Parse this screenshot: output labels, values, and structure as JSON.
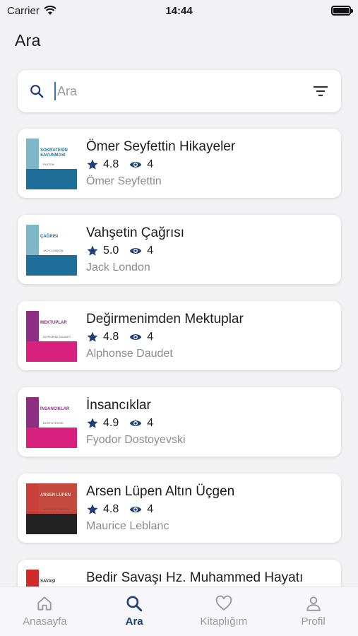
{
  "status_bar": {
    "carrier": "Carrier",
    "time": "14:44"
  },
  "page_title": "Ara",
  "search": {
    "placeholder": "Ara",
    "value": ""
  },
  "books": [
    {
      "title": "Ömer Seyfettin Hikayeler",
      "rating": "4.8",
      "views": "4",
      "author": "Ömer Seyfettin",
      "cover": {
        "band": "#7fb6c8",
        "bottom": "#1f6e9a",
        "bg": "#ffffff",
        "text": "SOKRATESİN SAVUNMASI",
        "text_color": "#1f6e9a",
        "sub": "PLATON"
      }
    },
    {
      "title": "Vahşetin Çağrısı",
      "rating": "5.0",
      "views": "4",
      "author": "Jack London",
      "cover": {
        "band": "#7fb6c8",
        "bottom": "#1f6e9a",
        "bg": "#ffffff",
        "text": "ÇAĞRISI",
        "text_color": "#1f6e9a",
        "sub": "JACK LONDON"
      }
    },
    {
      "title": "Değirmenimden Mektuplar",
      "rating": "4.8",
      "views": "4",
      "author": "Alphonse Daudet",
      "cover": {
        "band": "#8e2e83",
        "bottom": "#d8207e",
        "bg": "#ffffff",
        "text": "MEKTUPLAR",
        "text_color": "#8e2e83",
        "sub": "ALPHONSE DAUDET"
      }
    },
    {
      "title": "İnsancıklar",
      "rating": "4.9",
      "views": "4",
      "author": "Fyodor Dostoyevski",
      "cover": {
        "band": "#8e2e83",
        "bottom": "#d8207e",
        "bg": "#ffffff",
        "text": "İNSANCIKLAR",
        "text_color": "#8e2e83",
        "sub": "DOSTOYEVSKİ"
      }
    },
    {
      "title": "Arsen Lüpen Altın Üçgen",
      "rating": "4.8",
      "views": "4",
      "author": "Maurice Leblanc",
      "cover": {
        "band": "#c9403a",
        "bottom": "#222222",
        "bg": "#c44a40",
        "text": "ARSEN LÜPEN",
        "text_color": "#f3d9c8",
        "sub": "MAURICE LEBLANC"
      }
    },
    {
      "title": "Bedir Savaşı Hz. Muhammed Hayatı",
      "rating": "",
      "views": "",
      "author": "",
      "cover": {
        "band": "#d02a2a",
        "bottom": "#ffffff",
        "bg": "#ffffff",
        "text": "SAVAŞI",
        "text_color": "#333333",
        "sub": ""
      }
    }
  ],
  "tabs": [
    {
      "label": "Anasayfa",
      "icon": "home-icon",
      "active": false
    },
    {
      "label": "Ara",
      "icon": "search-icon",
      "active": true
    },
    {
      "label": "Kitaplığım",
      "icon": "heart-icon",
      "active": false
    },
    {
      "label": "Profil",
      "icon": "person-icon",
      "active": false
    }
  ],
  "colors": {
    "accent": "#1e3f7a",
    "inactive": "#9a9a9f"
  }
}
